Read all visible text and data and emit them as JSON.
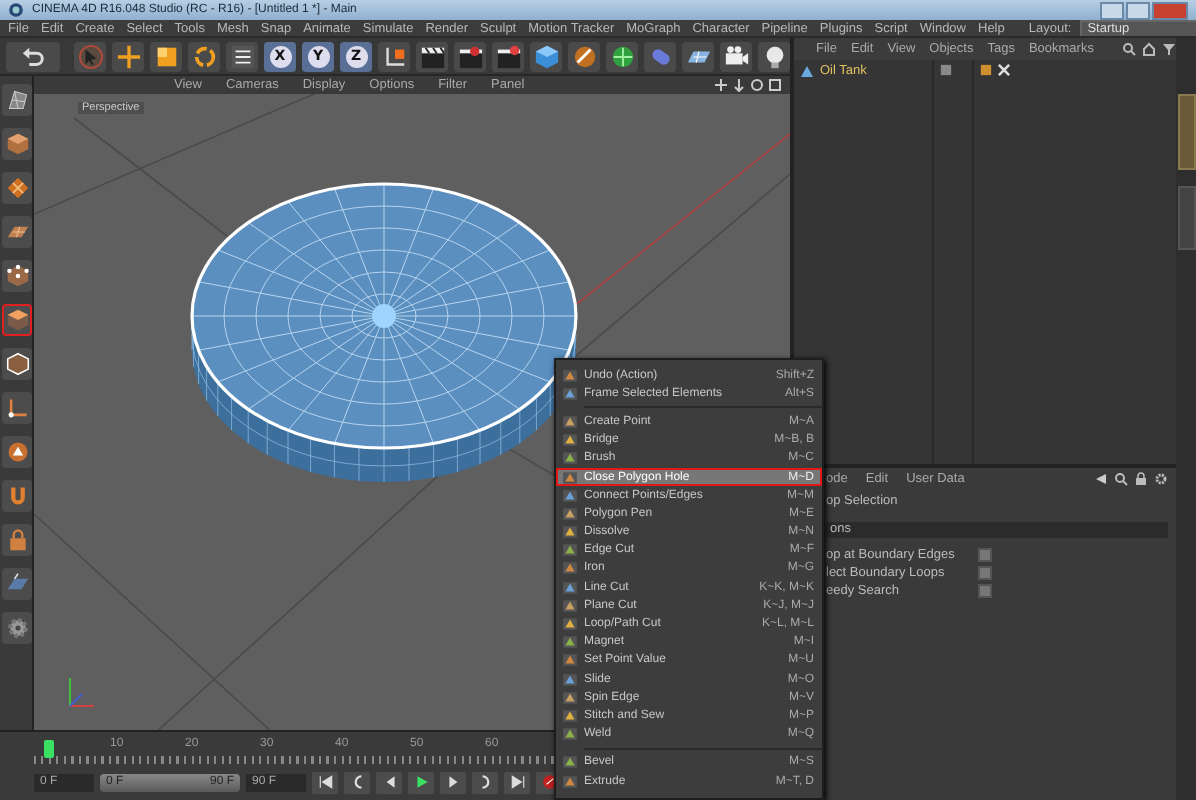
{
  "window": {
    "title": "CINEMA 4D R16.048 Studio (RC - R16) - [Untitled 1 *] - Main"
  },
  "menu_bar": {
    "items": [
      "File",
      "Edit",
      "Create",
      "Select",
      "Tools",
      "Mesh",
      "Snap",
      "Animate",
      "Simulate",
      "Render",
      "Sculpt",
      "Motion Tracker",
      "MoGraph",
      "Character",
      "Pipeline",
      "Plugins",
      "Script",
      "Window",
      "Help"
    ],
    "layout_label": "Layout:",
    "layout_value": "Startup"
  },
  "toolbar": {
    "left": [
      {
        "kind": "undo"
      },
      {
        "kind": "select"
      },
      {
        "kind": "move"
      },
      {
        "kind": "scale"
      },
      {
        "kind": "rotate"
      },
      {
        "kind": "coords"
      }
    ],
    "axes": [
      {
        "label": "X",
        "on": true
      },
      {
        "label": "Y",
        "on": true
      },
      {
        "label": "Z",
        "on": true
      }
    ],
    "right": [
      {
        "kind": "axis-system"
      },
      {
        "kind": "render"
      },
      {
        "kind": "render-view"
      },
      {
        "kind": "render-settings"
      },
      {
        "kind": "cube"
      },
      {
        "kind": "pen"
      },
      {
        "kind": "subdivision"
      },
      {
        "kind": "deformer"
      },
      {
        "kind": "floor"
      },
      {
        "kind": "camera"
      },
      {
        "kind": "light"
      }
    ]
  },
  "left_toolbar": {
    "items": [
      {
        "kind": "editable",
        "selected": false
      },
      {
        "kind": "model",
        "selected": false
      },
      {
        "kind": "texture",
        "selected": false
      },
      {
        "kind": "workplane",
        "selected": false
      },
      {
        "kind": "points",
        "selected": false
      },
      {
        "kind": "polygons",
        "selected": true
      },
      {
        "kind": "edges",
        "selected": false
      },
      {
        "kind": "axis",
        "selected": false
      },
      {
        "kind": "tweak",
        "selected": false
      },
      {
        "kind": "snap",
        "selected": false
      },
      {
        "kind": "lock",
        "selected": false
      },
      {
        "kind": "planar",
        "selected": false
      },
      {
        "kind": "solo",
        "selected": false
      }
    ]
  },
  "viewport": {
    "menu": [
      "View",
      "Cameras",
      "Display",
      "Options",
      "Filter",
      "Panel"
    ],
    "camera_label": "Perspective"
  },
  "object_manager": {
    "menu": [
      "File",
      "Edit",
      "View",
      "Objects",
      "Tags",
      "Bookmarks"
    ],
    "objects": [
      {
        "name": "Oil Tank"
      }
    ]
  },
  "attribute_manager": {
    "menu": [
      "ode",
      "Edit",
      "User Data"
    ],
    "title": "op Selection",
    "section": "ons",
    "options": [
      {
        "label": "op at Boundary Edges",
        "checked": false
      },
      {
        "label": "lect Boundary Loops",
        "checked": false
      },
      {
        "label": "eedy Search",
        "checked": false
      }
    ]
  },
  "timeline": {
    "ruler": [
      "10",
      "20",
      "30",
      "40",
      "50",
      "60"
    ],
    "start": "0 F",
    "range": {
      "start": "0 F",
      "end": "90 F",
      "level": 1
    },
    "end": "90 F"
  },
  "context_menu": {
    "sections": [
      {
        "items": [
          {
            "label": "Undo (Action)",
            "shortcut": "Shift+Z",
            "selected": false
          },
          {
            "label": "Frame Selected Elements",
            "shortcut": "Alt+S",
            "selected": false
          }
        ]
      },
      {
        "items": [
          {
            "label": "Create Point",
            "shortcut": "M~A",
            "selected": false
          },
          {
            "label": "Bridge",
            "shortcut": "M~B, B",
            "selected": false
          },
          {
            "label": "Brush",
            "shortcut": "M~C",
            "selected": false
          },
          {
            "label": "Close Polygon Hole",
            "shortcut": "M~D",
            "selected": true
          },
          {
            "label": "Connect Points/Edges",
            "shortcut": "M~M",
            "selected": false
          },
          {
            "label": "Polygon Pen",
            "shortcut": "M~E",
            "selected": false
          },
          {
            "label": "Dissolve",
            "shortcut": "M~N",
            "selected": false
          },
          {
            "label": "Edge Cut",
            "shortcut": "M~F",
            "selected": false
          },
          {
            "label": "Iron",
            "shortcut": "M~G",
            "selected": false
          },
          {
            "label": "Line Cut",
            "shortcut": "K~K, M~K",
            "selected": false
          },
          {
            "label": "Plane Cut",
            "shortcut": "K~J, M~J",
            "selected": false
          },
          {
            "label": "Loop/Path Cut",
            "shortcut": "K~L, M~L",
            "selected": false
          },
          {
            "label": "Magnet",
            "shortcut": "M~I",
            "selected": false
          },
          {
            "label": "Set Point Value",
            "shortcut": "M~U",
            "selected": false
          },
          {
            "label": "Slide",
            "shortcut": "M~O",
            "selected": false
          },
          {
            "label": "Spin Edge",
            "shortcut": "M~V",
            "selected": false
          },
          {
            "label": "Stitch and Sew",
            "shortcut": "M~P",
            "selected": false
          },
          {
            "label": "Weld",
            "shortcut": "M~Q",
            "selected": false
          }
        ]
      },
      {
        "items": [
          {
            "label": "Bevel",
            "shortcut": "M~S",
            "selected": false
          },
          {
            "label": "Extrude",
            "shortcut": "M~T, D",
            "selected": false
          }
        ]
      }
    ]
  }
}
